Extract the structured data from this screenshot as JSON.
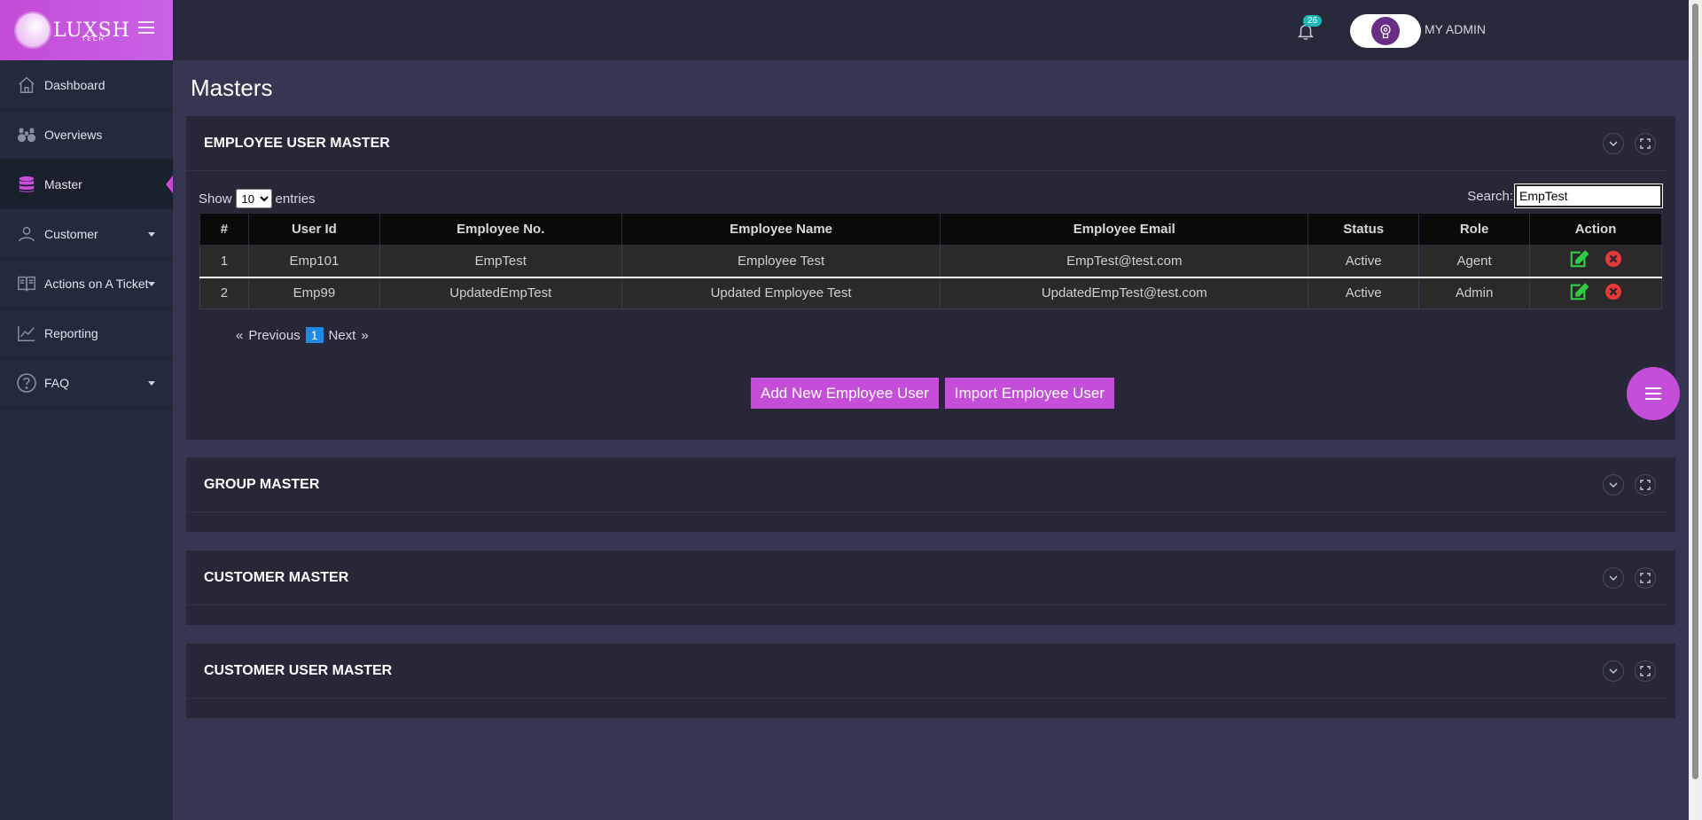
{
  "brand": {
    "name": "LUXSH",
    "sub": "TECH"
  },
  "sidebar": {
    "items": [
      {
        "label": "Dashboard"
      },
      {
        "label": "Overviews"
      },
      {
        "label": "Master"
      },
      {
        "label": "Customer"
      },
      {
        "label": "Actions on A Ticket"
      },
      {
        "label": "Reporting"
      },
      {
        "label": "FAQ"
      }
    ]
  },
  "topbar": {
    "notification_count": "26",
    "admin_name": "MY ADMIN"
  },
  "page": {
    "title": "Masters"
  },
  "employee_panel": {
    "title": "EMPLOYEE USER MASTER",
    "show_label": "Show",
    "entries_value": "10",
    "entries_label": "entries",
    "search_label": "Search:",
    "search_value": "EmpTest",
    "columns": [
      "#",
      "User Id",
      "Employee No.",
      "Employee Name",
      "Employee Email",
      "Status",
      "Role",
      "Action"
    ],
    "rows": [
      [
        "1",
        "Emp101",
        "EmpTest",
        "Employee Test",
        "EmpTest@test.com",
        "Active",
        "Agent"
      ],
      [
        "2",
        "Emp99",
        "UpdatedEmpTest",
        "Updated Employee Test",
        "UpdatedEmpTest@test.com",
        "Active",
        "Admin"
      ]
    ],
    "pager": {
      "first": "«",
      "previous": "Previous",
      "page": "1",
      "next": "Next",
      "last": "»"
    },
    "add_button": "Add New Employee User",
    "import_button": "Import Employee User"
  },
  "panels": [
    {
      "title": "GROUP MASTER"
    },
    {
      "title": "CUSTOMER MASTER"
    },
    {
      "title": "CUSTOMER USER MASTER"
    }
  ],
  "colors": {
    "accent": "#c54ed8",
    "sidebar": "#232a3b",
    "background": "#363552",
    "edit": "#2ecc40",
    "delete": "#e53935"
  }
}
